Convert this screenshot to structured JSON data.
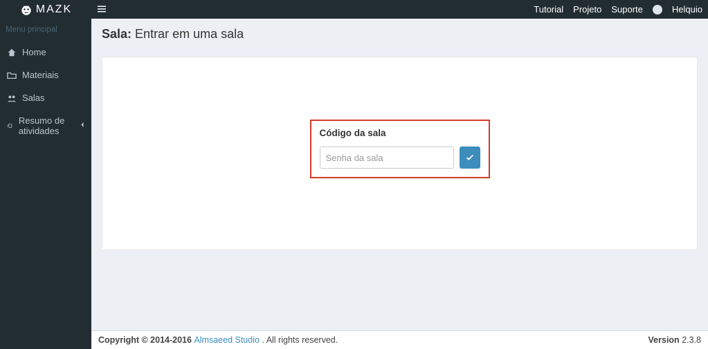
{
  "brand": "MAZK",
  "top": {
    "links": [
      "Tutorial",
      "Projeto",
      "Suporte"
    ],
    "user": "Helquio"
  },
  "sidebar": {
    "header": "Menu principal",
    "items": [
      {
        "label": "Home",
        "icon": "home-icon"
      },
      {
        "label": "Materiais",
        "icon": "folder-icon"
      },
      {
        "label": "Salas",
        "icon": "users-icon"
      },
      {
        "label": "Resumo de atividades",
        "icon": "refresh-icon",
        "expandable": true
      }
    ]
  },
  "page": {
    "title_prefix": "Sala:",
    "title_sub": "Entrar em uma sala"
  },
  "card": {
    "title": "Código da sala",
    "input_placeholder": "Senha da sala"
  },
  "footer": {
    "copyright": "Copyright © 2014-2016 ",
    "link": "Almsaeed Studio",
    "tail": ". All rights reserved.",
    "version_label": "Version",
    "version": "2.3.8"
  },
  "colors": {
    "accent": "#3c8dbc",
    "danger": "#d73925",
    "sidebar": "#222d32"
  }
}
